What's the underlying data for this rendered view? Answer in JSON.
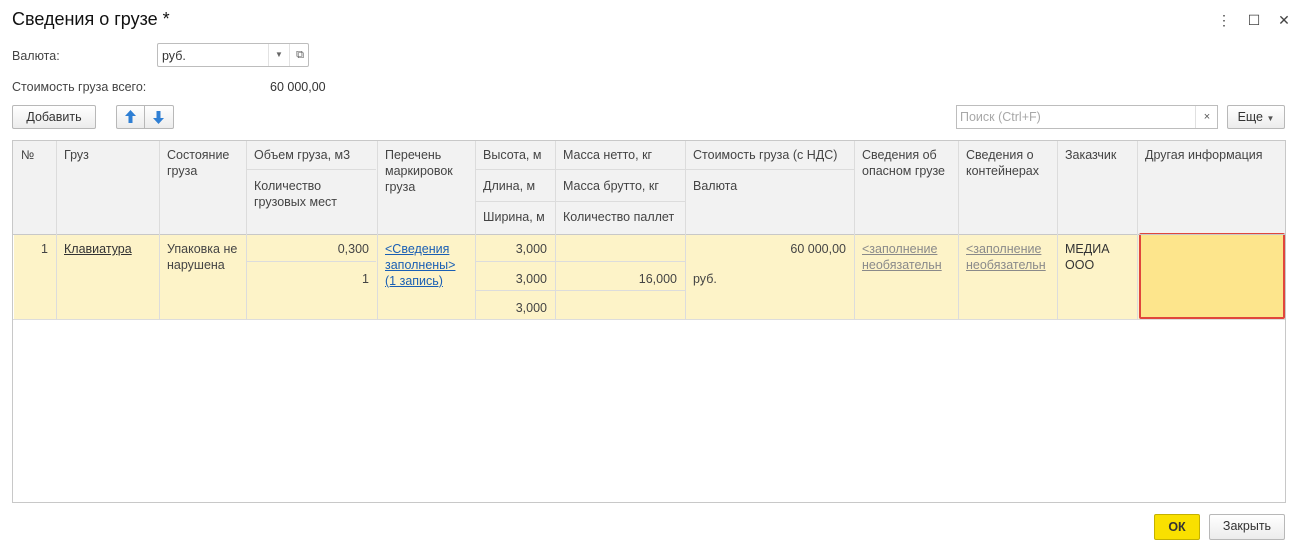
{
  "window": {
    "title": "Сведения о грузе *",
    "menu_icon": "⋮",
    "maximize_icon": "☐",
    "close_icon": "✕"
  },
  "currency": {
    "label": "Валюта:",
    "value": "руб."
  },
  "total_cost": {
    "label": "Стоимость груза всего:",
    "value": "60 000,00"
  },
  "toolbar": {
    "add_label": "Добавить",
    "search_placeholder": "Поиск (Ctrl+F)",
    "search_clear": "×",
    "more_label": "Еще"
  },
  "table": {
    "headers": {
      "num": "№",
      "cargo": "Груз",
      "state": "Состояние груза",
      "volume": "Объем груза, м3",
      "places": "Количество грузовых мест",
      "markings": "Перечень маркировок груза",
      "height": "Высота, м",
      "length": "Длина, м",
      "width": "Ширина, м",
      "net_mass": "Масса нетто, кг",
      "gross_mass": "Масса брутто, кг",
      "pallets": "Количество паллет",
      "cost": "Стоимость груза (с НДС)",
      "currency": "Валюта",
      "hazard": "Сведения об опасном грузе",
      "containers": "Сведения о контейнерах",
      "customer": "Заказчик",
      "other": "Другая информация"
    },
    "rows": [
      {
        "num": "1",
        "cargo": "Клавиатура",
        "state": "Упаковка не нарушена",
        "volume": "0,300",
        "places": "1",
        "markings": "<Сведения заполнены> (1 запись)",
        "height": "3,000",
        "length": "3,000",
        "width": "3,000",
        "net_mass": "",
        "gross_mass": "16,000",
        "pallets": "",
        "cost": "60 000,00",
        "currency": "руб.",
        "hazard": "<заполнение необязательн",
        "containers": "<заполнение необязательн",
        "customer": "МЕДИА ООО",
        "other": ""
      }
    ]
  },
  "footer": {
    "ok_label": "ОК",
    "close_label": "Закрыть"
  },
  "colors": {
    "row_highlight": "#fdf3c8",
    "selected_cell": "#fde58c",
    "selected_border": "#e0463c",
    "ok_button": "#f9e000",
    "link": "#1a5fb4"
  }
}
